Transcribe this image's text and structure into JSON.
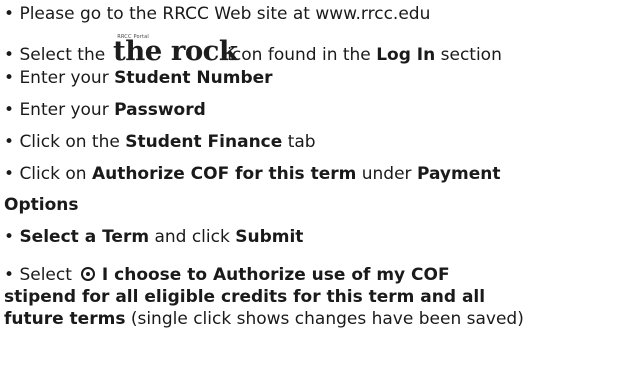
{
  "bullet": "•",
  "steps": {
    "s1": {
      "text": "Please go to the RRCC Web site at www.rrcc.edu"
    },
    "s2": {
      "pre": "Select the",
      "logo_small": "RRCC Portal",
      "logo_text": "the rock",
      "post": "icon found in the",
      "bold": "Log In",
      "tail": "section"
    },
    "s3": {
      "pre": "Enter your",
      "bold": "Student Number"
    },
    "s4": {
      "pre": "Enter your",
      "bold": "Password"
    },
    "s5": {
      "pre": "Click on the",
      "bold": "Student Finance",
      "tail": "tab"
    },
    "s6": {
      "pre": "Click on",
      "bold1": "Authorize COF for this term",
      "mid": "under",
      "bold2": "Payment",
      "bold3": "Options"
    },
    "s7": {
      "bold1": "Select a Term",
      "mid": "and click",
      "bold2": "Submit"
    },
    "s8": {
      "pre": "Select",
      "radio_icon": "radio-selected-icon",
      "bold_line1": "I choose to Authorize use of my COF",
      "bold_line2": "stipend for all eligible credits for this term and all",
      "bold_line3": "future terms",
      "tail": "(single click shows changes have been saved)"
    }
  }
}
